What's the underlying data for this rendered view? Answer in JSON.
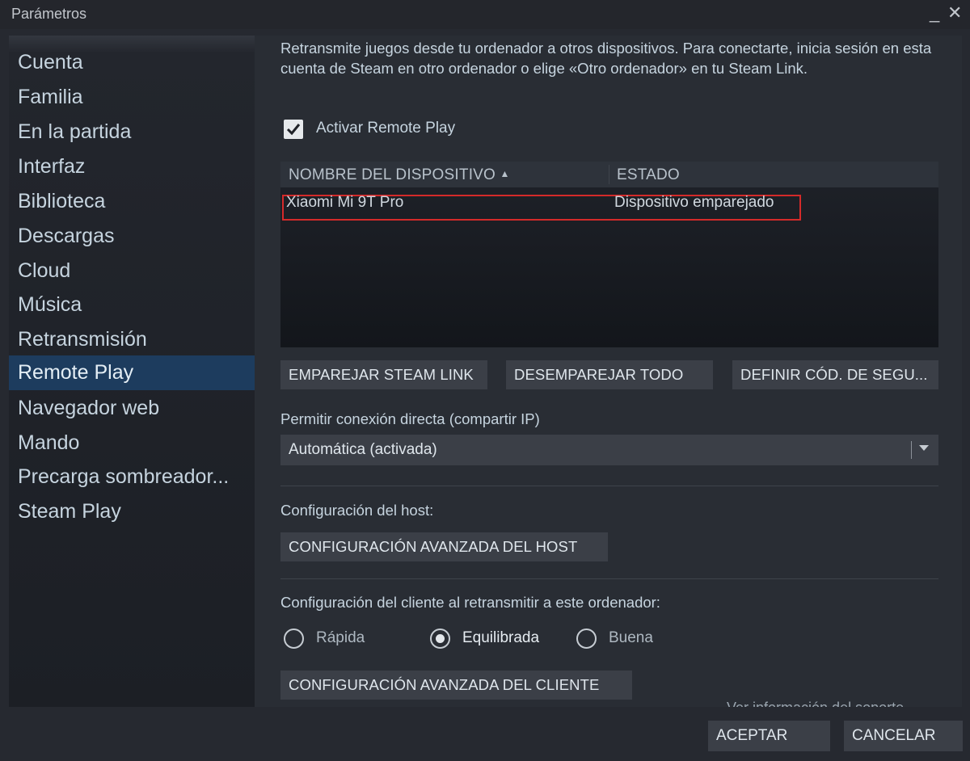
{
  "window": {
    "title": "Parámetros",
    "minimize_symbol": "_",
    "close_symbol": "✕"
  },
  "sidebar": {
    "items": [
      {
        "label": "Cuenta"
      },
      {
        "label": "Familia"
      },
      {
        "label": "En la partida"
      },
      {
        "label": "Interfaz"
      },
      {
        "label": "Biblioteca"
      },
      {
        "label": "Descargas"
      },
      {
        "label": "Cloud"
      },
      {
        "label": "Música"
      },
      {
        "label": "Retransmisión"
      },
      {
        "label": "Remote Play",
        "active": true
      },
      {
        "label": "Navegador web"
      },
      {
        "label": "Mando"
      },
      {
        "label": "Precarga sombreador..."
      },
      {
        "label": "Steam Play"
      }
    ]
  },
  "main": {
    "description": "Retransmite juegos desde tu ordenador a otros dispositivos. Para conectarte, inicia sesión en esta cuenta de Steam en otro ordenador o elige «Otro ordenador» en tu Steam Link.",
    "enable_remote_play": {
      "label": "Activar Remote Play",
      "checked": true
    },
    "devices_table": {
      "columns": {
        "name": "NOMBRE DEL DISPOSITIVO",
        "sort_icon": "▲",
        "state": "ESTADO"
      },
      "rows": [
        {
          "name": "Xiaomi Mi 9T Pro",
          "state": "Dispositivo emparejado"
        }
      ]
    },
    "buttons": {
      "pair": "EMPAREJAR STEAM LINK",
      "unpair_all": "DESEMPAREJAR TODO",
      "set_code": "DEFINIR CÓD. DE SEGU..."
    },
    "direct_connection": {
      "label": "Permitir conexión directa (compartir IP)",
      "value": "Automática (activada)"
    },
    "host": {
      "label": "Configuración del host:",
      "button": "CONFIGURACIÓN AVANZADA DEL HOST"
    },
    "client": {
      "label": "Configuración del cliente al retransmitir a este ordenador:",
      "options": [
        {
          "label": "Rápida"
        },
        {
          "label": "Equilibrada",
          "selected": true
        },
        {
          "label": "Buena"
        }
      ],
      "button": "CONFIGURACIÓN AVANZADA DEL CLIENTE"
    },
    "support_link": "Ver información del soporte"
  },
  "footer": {
    "accept": "ACEPTAR",
    "cancel": "CANCELAR"
  },
  "colors": {
    "highlight_border": "#d42a2a",
    "active_item_bg": "#1d3c5e"
  }
}
